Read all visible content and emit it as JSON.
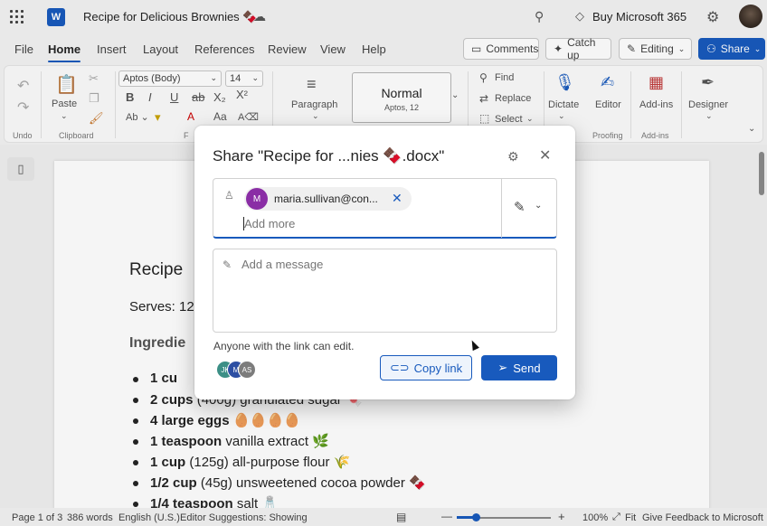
{
  "titlebar": {
    "doc_title": "Recipe for Delicious Brownies 🍫",
    "buy_label": "Buy Microsoft 365",
    "app_letter": "W"
  },
  "menu": {
    "items": [
      "File",
      "Home",
      "Insert",
      "Layout",
      "References",
      "Review",
      "View",
      "Help"
    ],
    "active": "Home",
    "comments": "Comments",
    "catchup": "Catch up",
    "editing": "Editing",
    "share": "Share"
  },
  "ribbon": {
    "undo_group": "Undo",
    "paste": "Paste",
    "clipboard_group": "Clipboard",
    "font_name": "Aptos (Body)",
    "font_size": "14",
    "paragraph": "Paragraph",
    "style_name": "Normal",
    "style_sub": "Aptos, 12",
    "find": "Find",
    "replace": "Replace",
    "select": "Select",
    "dictate": "Dictate",
    "editor": "Editor",
    "addins": "Add-ins",
    "designer": "Designer",
    "proofing_group": "Proofing",
    "addins_group": "Add-ins",
    "font_group_letter": "F"
  },
  "document": {
    "heading": "Recipe",
    "serves": "Serves: 12",
    "ingredients_heading": "Ingredie",
    "ingredients": [
      {
        "bold": "1 cu",
        "rest": ""
      },
      {
        "bold": "2 cups",
        "rest": " (400g) granulated sugar 🍬"
      },
      {
        "bold": "4 large eggs",
        "rest": " 🥚🥚🥚🥚"
      },
      {
        "bold": "1 teaspoon",
        "rest": " vanilla extract 🌿"
      },
      {
        "bold": "1 cup",
        "rest": " (125g) all-purpose flour 🌾"
      },
      {
        "bold": "1/2 cup",
        "rest": " (45g) unsweetened cocoa powder 🍫"
      },
      {
        "bold": "1/4 teaspoon",
        "rest": " salt 🧂"
      }
    ]
  },
  "statusbar": {
    "page": "Page 1 of 3",
    "words": "386 words",
    "language": "English (U.S.)",
    "editor": "Editor Suggestions: Showing",
    "zoom": "100%",
    "zoom_level": 0.2,
    "fit": "Fit",
    "feedback": "Give Feedback to Microsoft"
  },
  "dialog": {
    "title": "Share \"Recipe for ...nies 🍫.docx\"",
    "recipient_initial": "M",
    "recipient": "maria.sullivan@con...",
    "add_more_placeholder": "Add more",
    "message_placeholder": "Add a message",
    "link_note": "Anyone with the link can edit.",
    "avatars": [
      "JK",
      "M",
      "AS"
    ],
    "copy_link": "Copy link",
    "send": "Send"
  },
  "colors": {
    "accent": "#185abd",
    "chip_avatar": "#8a2da5"
  }
}
